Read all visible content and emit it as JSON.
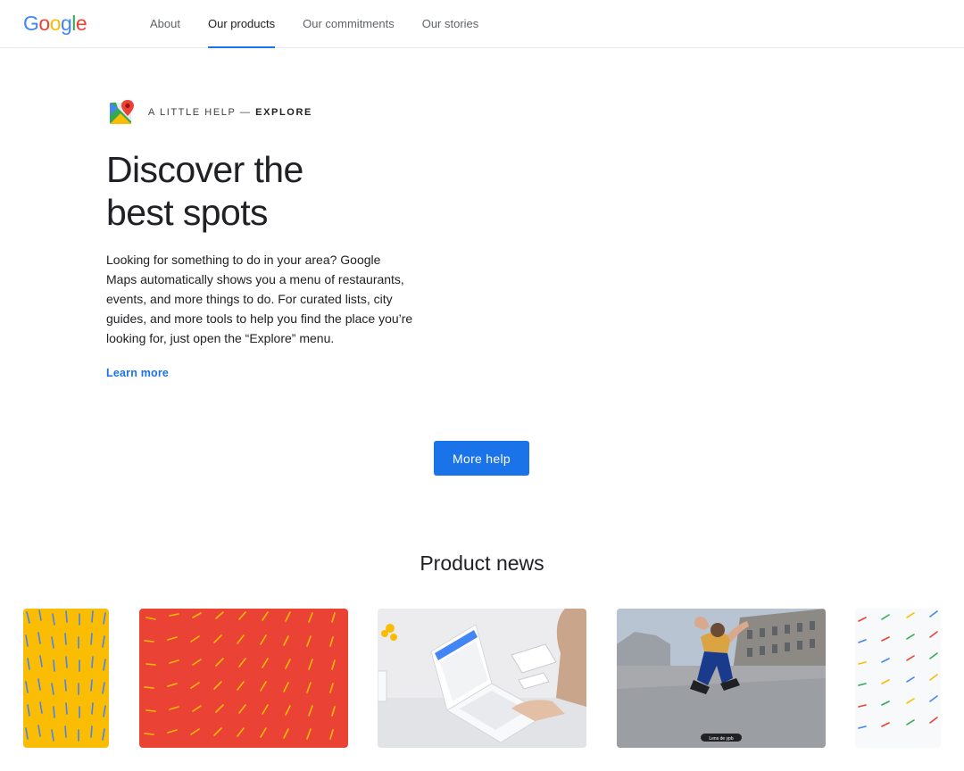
{
  "header": {
    "logo_letters": [
      "G",
      "o",
      "o",
      "g",
      "l",
      "e"
    ],
    "logo_colors": [
      "#4285f4",
      "#ea4335",
      "#fbbc04",
      "#4285f4",
      "#34a853",
      "#ea4335"
    ],
    "nav": [
      {
        "label": "About",
        "active": false
      },
      {
        "label": "Our products",
        "active": true
      },
      {
        "label": "Our commitments",
        "active": false
      },
      {
        "label": "Our stories",
        "active": false
      }
    ]
  },
  "hero": {
    "icon": "google-maps-icon",
    "eyebrow_prefix": "A LITTLE HELP — ",
    "eyebrow_strong": "EXPLORE",
    "title_line1": "Discover the",
    "title_line2": "best spots",
    "body": "Looking for something to do in your area? Google Maps automatically shows you a menu of restaurants, events, and more things to do. For curated lists, city guides, and more tools to help you find the place you’re looking for, just open the “Explore” menu.",
    "learn_more": "Learn more"
  },
  "more_help_label": "More help",
  "product_news": {
    "title": "Product news",
    "cards": [
      {
        "name": "news-card-yellow-pattern",
        "kind": "pattern",
        "background": "#fbbc04",
        "accent": "#4285f4"
      },
      {
        "name": "news-card-red-pattern",
        "kind": "pattern",
        "background": "#ea4335",
        "accent": "#fbbc04"
      },
      {
        "name": "news-card-laptop-photo",
        "kind": "photo"
      },
      {
        "name": "news-card-street-photo",
        "kind": "photo",
        "caption": "Lens de ypb"
      },
      {
        "name": "news-card-multicolor-pattern",
        "kind": "pattern",
        "background": "#f8f9fa"
      }
    ]
  },
  "colors": {
    "accent": "#1a73e8",
    "text": "#202124",
    "muted": "#5f6368"
  }
}
